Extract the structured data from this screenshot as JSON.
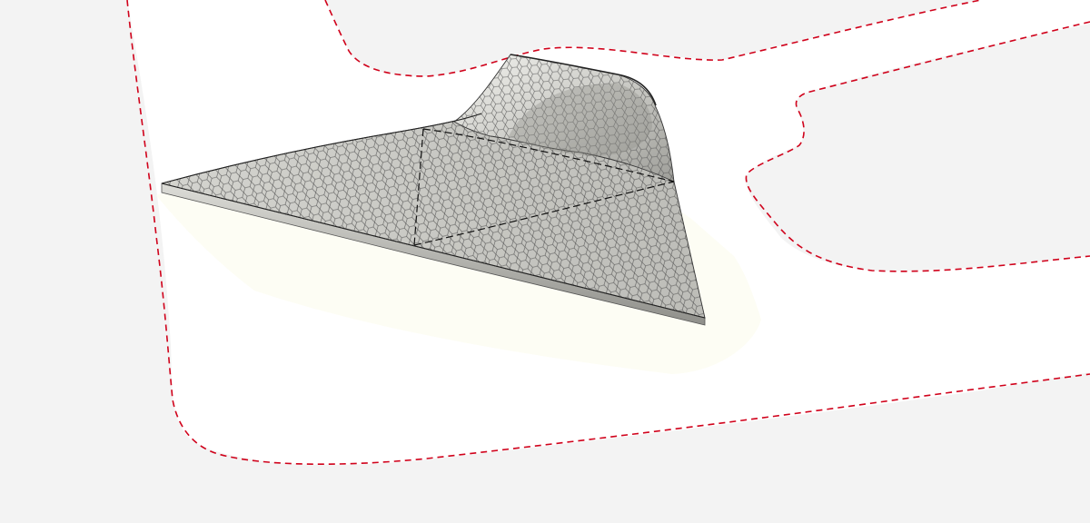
{
  "colors": {
    "background": "#f3f3f3",
    "site_area": "#ffffff",
    "boundary_line": "#d0021b",
    "shadow": "#fdfdf4",
    "panel_top": "#c9c9c4",
    "panel_light": "#e8e8e3",
    "panel_edge": "#9a9a96",
    "cell_line": "#555555",
    "section_line": "#111111"
  },
  "scene": {
    "view": "3d-perspective",
    "surface_pattern": "hexagonal-grid",
    "boundary_style": "red-dashed",
    "section_style": "black-dashed"
  }
}
